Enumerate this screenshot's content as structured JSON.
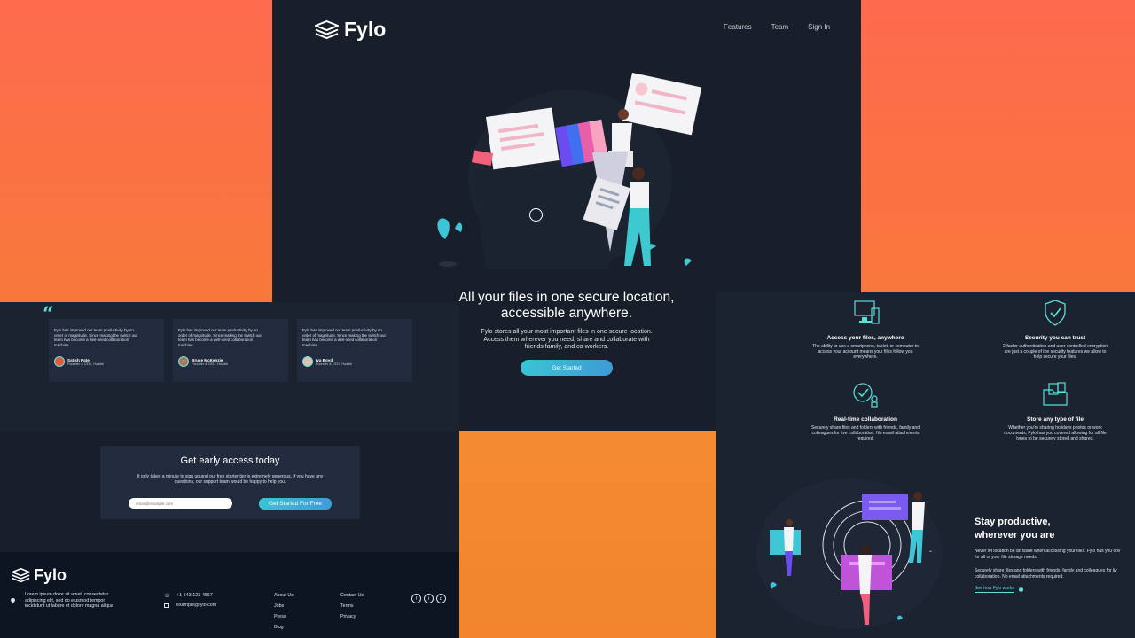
{
  "colors": {
    "accent": "#3ac4d4",
    "bg": "#1b2331",
    "hero_bg": "#181f2a",
    "card_bg": "#212b3d",
    "footer_bg": "#0d1523",
    "orange": "#fe6b4f"
  },
  "header": {
    "brand": "Fylo",
    "nav": [
      "Features",
      "Team",
      "Sign In"
    ]
  },
  "hero": {
    "title_line1": "All your files in one secure location,",
    "title_line2": "accessible anywhere.",
    "desc_line1": "Fylo stores all your most important files in one secure location.",
    "desc_line2": "Access them wherever you need, share and collaborate with",
    "desc_line3": "friends family, and co-workers.",
    "cta": "Get Started"
  },
  "features": [
    {
      "icon": "monitor-icon",
      "title": "Access your files, anywhere",
      "lines": [
        "The ability to use a smartphone, tablet, or computer to",
        "access your account means your files follow you",
        "everywhere."
      ]
    },
    {
      "icon": "shield-check-icon",
      "title": "Security you can trust",
      "lines": [
        "2-factor authentication and user-controlled encryption",
        "are just a couple of the security features we allow to",
        "help secure your files."
      ]
    },
    {
      "icon": "collaboration-icon",
      "title": "Real-time collaboration",
      "lines": [
        "Securely share files and folders with friends, family and",
        "colleagues for live collaboration. No email attachments",
        "required."
      ]
    },
    {
      "icon": "folder-files-icon",
      "title": "Store any type of file",
      "lines": [
        "Whether you're sharing holidays photos or work",
        "documents, Fylo has you covered allowing for all file",
        "types to be securely stored and shared."
      ]
    }
  ],
  "testimonials": [
    {
      "text": [
        "Fylo has improved our team productivity by an",
        "order of magnitude. Since making the switch our",
        "team has become a well-oiled collaboration",
        "machine."
      ],
      "name": "Satish Patel",
      "role": "Founder & CEO, Huddle"
    },
    {
      "text": [
        "Fylo has improved our team productivity by an",
        "order of magnitude. Since making the switch our",
        "team has become a well-oiled collaboration",
        "machine."
      ],
      "name": "Bruce McKenzie",
      "role": "Founder & CEO, Huddle"
    },
    {
      "text": [
        "Fylo has improved our team productivity by an",
        "order of magnitude. Since making the switch our",
        "team has become a well-oiled collaboration",
        "machine."
      ],
      "name": "Iva Boyd",
      "role": "Founder & CEO, Huddle"
    }
  ],
  "early_access": {
    "title": "Get early access today",
    "desc_line1": "It only takes a minute to sign up and our free starter tier is extremely generous. If you have any",
    "desc_line2": "questions, our support team would be happy to help you.",
    "email_placeholder": "email@example.com",
    "button": "Get Started For Free"
  },
  "footer": {
    "brand": "Fylo",
    "address_line1": "Lorem ipsum dolor sit amet, consectetur",
    "address_line2": "adipiscing elit, sed do eiusmod tempor",
    "address_line3": "incididunt ut labore et dolore magna aliqua",
    "phone": "+1-543-123-4567",
    "email": "example@fylo.com",
    "col1": [
      "About Us",
      "Jobs",
      "Press",
      "Blog"
    ],
    "col2": [
      "Contact Us",
      "Terms",
      "Privacy"
    ],
    "social": [
      "facebook-icon",
      "twitter-icon",
      "instagram-icon"
    ]
  },
  "productive": {
    "title_line1": "Stay productive,",
    "title_line2": "wherever you are",
    "p1_line1": "Never let location be an issue when accessing your files. Fylo has you cov",
    "p1_line2": "for all of your file storage needs.",
    "p2_line1": "Securely share files and folders with friends, family and colleagues for liv",
    "p2_line2": "collaboration. No email attachments required.",
    "link": "See how Fylo works"
  }
}
